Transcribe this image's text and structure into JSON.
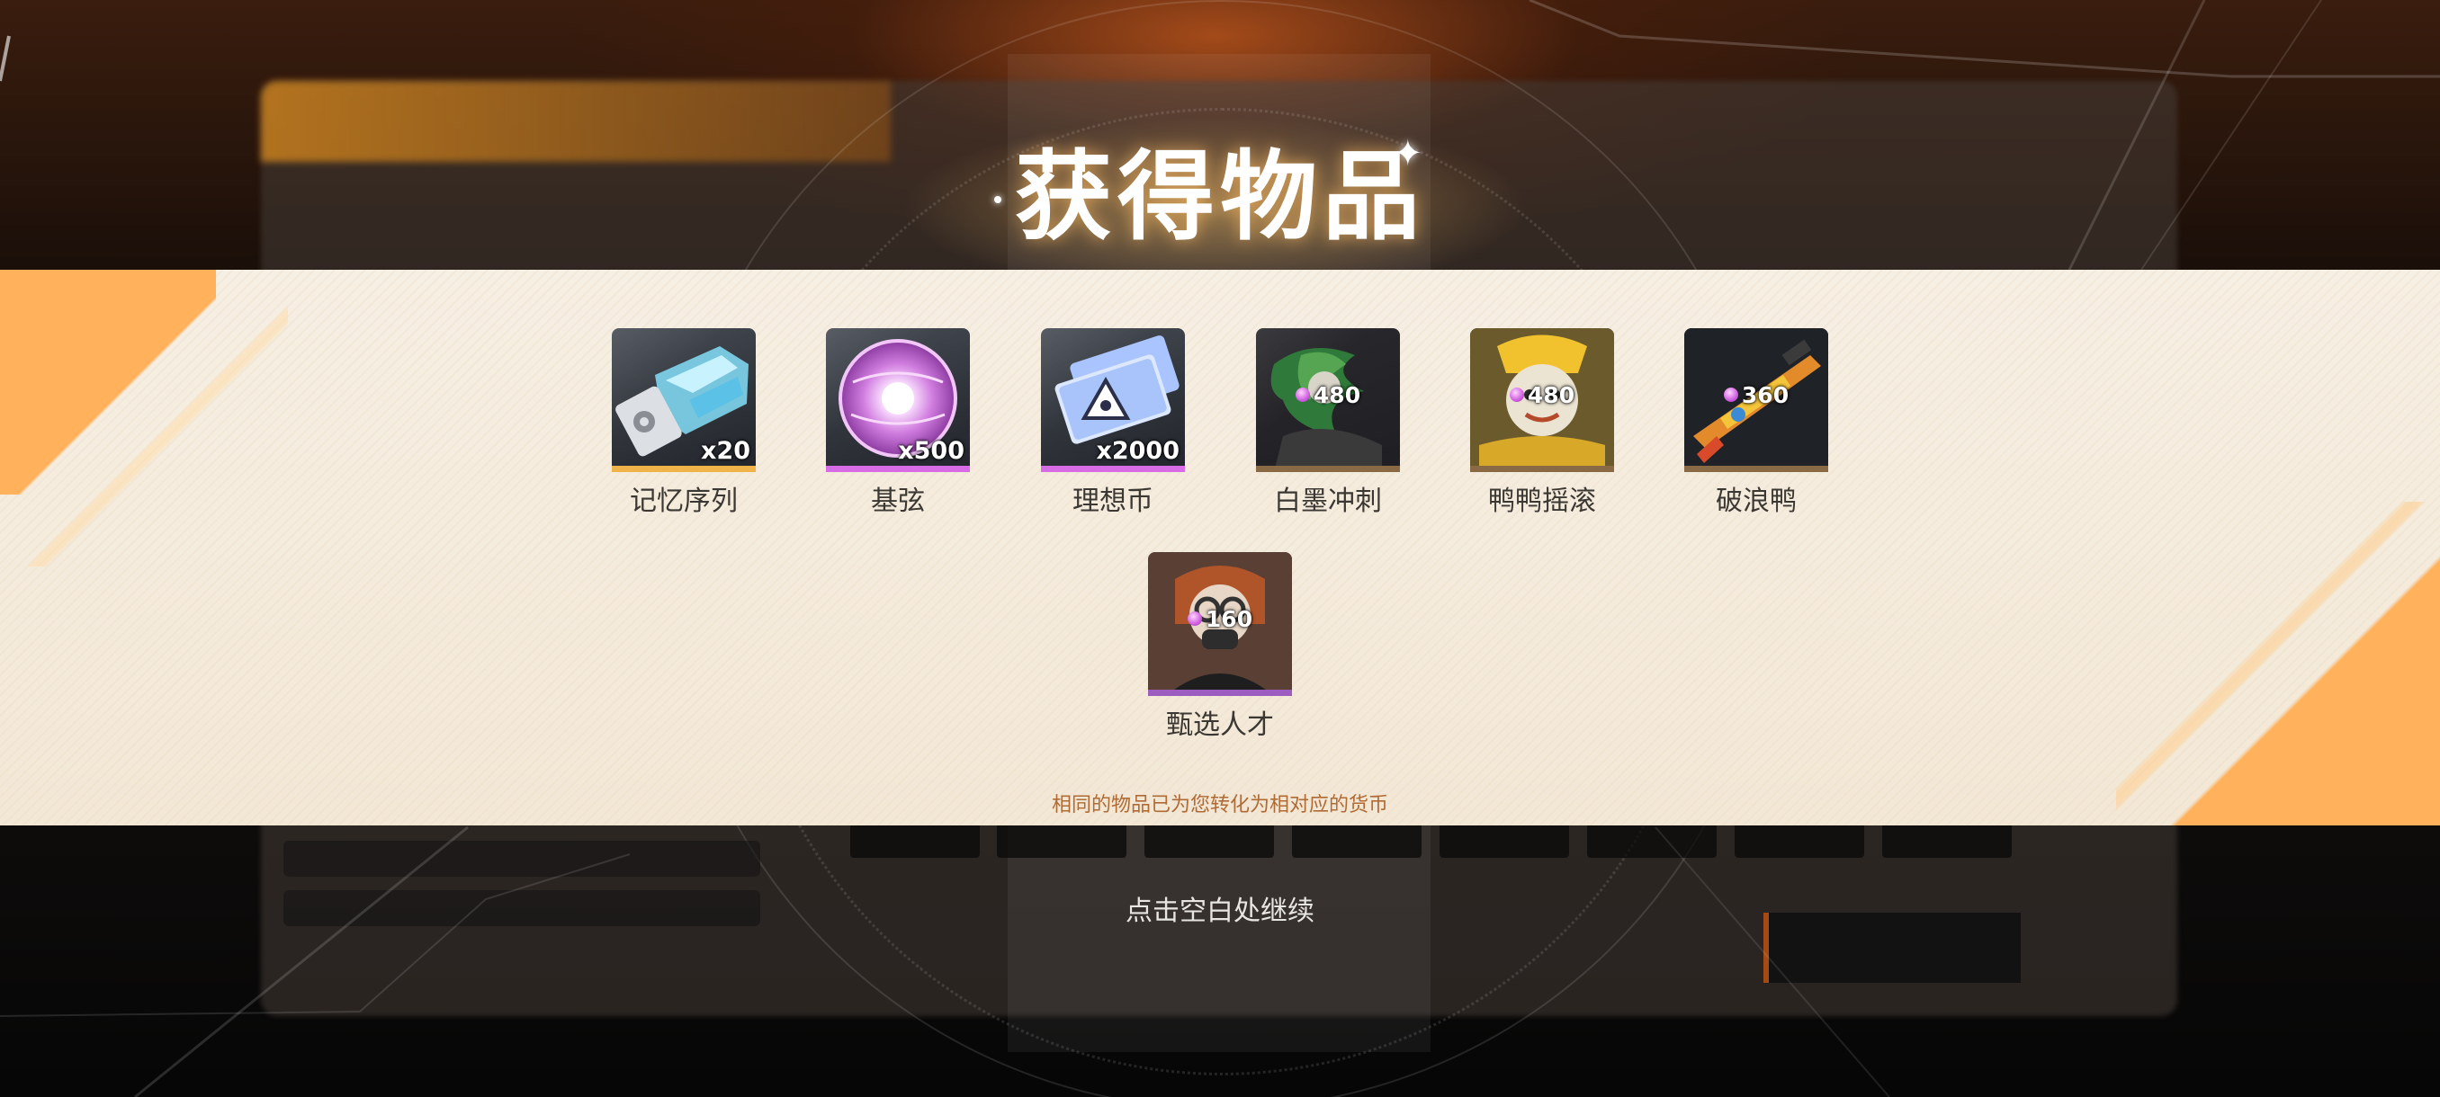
{
  "title": "获得物品",
  "items": [
    {
      "name": "记忆序列",
      "badge": "x20",
      "badge_type": "quantity",
      "rarity_color": "#f0b34a",
      "icon": "memory-sequence-icon"
    },
    {
      "name": "基弦",
      "badge": "x500",
      "badge_type": "quantity",
      "rarity_color": "#d86be6",
      "icon": "base-string-orb-icon"
    },
    {
      "name": "理想币",
      "badge": "x2000",
      "badge_type": "quantity",
      "rarity_color": "#d86be6",
      "icon": "ideal-coin-ticket-icon"
    },
    {
      "name": "白墨冲刺",
      "badge": "480",
      "badge_type": "price",
      "rarity_color": "#8a6a45",
      "icon": "white-ink-dash-art-icon"
    },
    {
      "name": "鸭鸭摇滚",
      "badge": "480",
      "badge_type": "price",
      "rarity_color": "#8a6a45",
      "icon": "duck-rock-art-icon"
    },
    {
      "name": "破浪鸭",
      "badge": "360",
      "badge_type": "price",
      "rarity_color": "#8a6a45",
      "icon": "wave-duck-weapon-icon"
    },
    {
      "name": "甄选人才",
      "badge": "160",
      "badge_type": "price",
      "rarity_color": "#9d5cc0",
      "icon": "selected-talent-portrait-icon"
    }
  ],
  "currency_icon": "gem-icon",
  "note": "相同的物品已为您转化为相对应的货币",
  "continue_hint": "点击空白处继续",
  "colors": {
    "band": "#f5ecdd",
    "accent_orange": "#ffb15c",
    "note_text": "#b06a34"
  }
}
